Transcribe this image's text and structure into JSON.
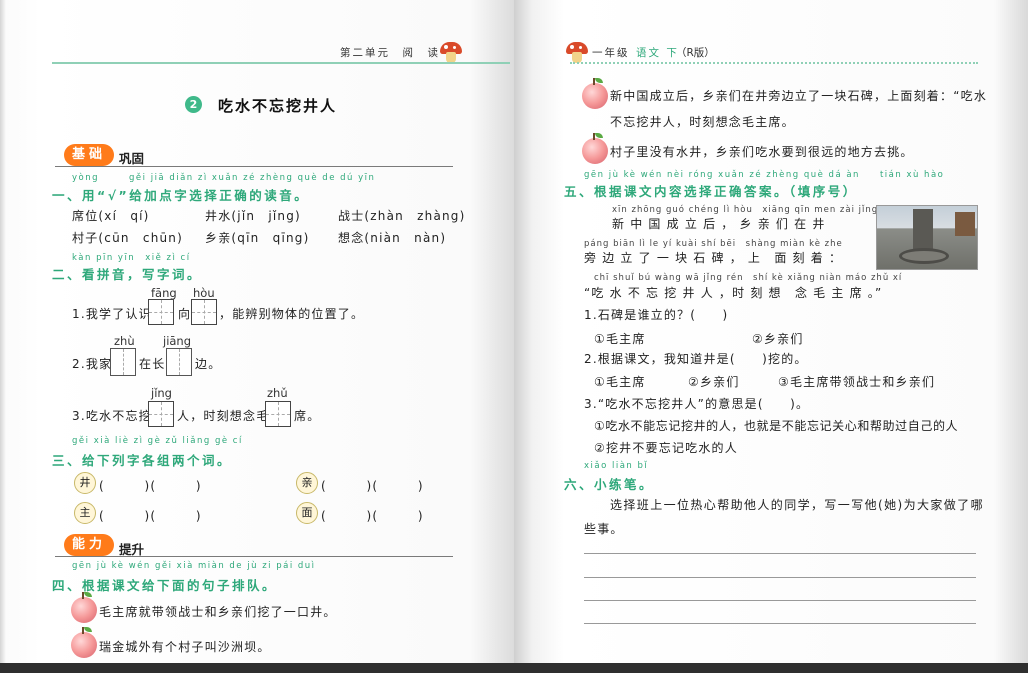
{
  "left_page": {
    "header": "第二单元　阅　读",
    "lesson_number": "2",
    "lesson_title": "吃水不忘挖井人",
    "basics_badge": "基础",
    "basics_label": "巩固",
    "q1": {
      "pinyin": "yòng　　　gěi jiā diǎn zì xuǎn zé zhèng què de dú yīn",
      "title": "一、用“√”给加点字选择正确的读音。",
      "row1": [
        "席位(xí　qí)",
        "井水(jǐn　jǐng)",
        "战士(zhàn　zhàng)"
      ],
      "row2": [
        "村子(cūn　chūn)",
        "乡亲(qīn　qīng)",
        "想念(niàn　nàn)"
      ]
    },
    "q2": {
      "pinyin": "kàn pīn yīn　xiě zì cí",
      "title": "二、看拼音，写字词。",
      "s1_py1": "fāng",
      "s1_py2": "hòu",
      "s1_a": "1.我学了认识",
      "s1_b": "向",
      "s1_c": "，能辨别物体的位置了。",
      "s2_py1": "zhù",
      "s2_py2": "jiāng",
      "s2_a": "2.我家",
      "s2_b": "在长",
      "s2_c": "边。",
      "s3_py1": "jǐng",
      "s3_py2": "zhǔ",
      "s3_a": "3.吃水不忘挖",
      "s3_b": "人，时刻想念毛",
      "s3_c": "席。"
    },
    "q3": {
      "pinyin": "gěi xià liè zì gè zǔ liǎng gè cí",
      "title": "三、给下列字各组两个词。",
      "chars": [
        "井",
        "亲",
        "主",
        "面"
      ],
      "blank": "(　　　)(　　　)"
    },
    "ability_badge": "能力",
    "ability_label": "提升",
    "q4": {
      "pinyin": "gēn jù kè wén gěi xià miàn de jù zi pái duì",
      "title": "四、根据课文给下面的句子排队。",
      "items": [
        "毛主席就带领战士和乡亲们挖了一口井。",
        "瑞金城外有个村子叫沙洲坝。"
      ]
    }
  },
  "right_page": {
    "header_grade": "一年级",
    "header_subject": "语文 下",
    "header_edition": "（R版）",
    "q4_items": [
      "新中国成立后，乡亲们在井旁边立了一块石碑，上面刻着：“吃水",
      "不忘挖井人，时刻想念毛主席。",
      "村子里没有水井，乡亲们吃水要到很远的地方去挑。"
    ],
    "q5": {
      "pinyin": "gēn jù kè wén nèi róng xuǎn zé zhèng què dá àn　　tián xù hào",
      "title": "五、根据课文内容选择正确答案。（填序号）",
      "passage_py1": "xīn zhōng guó chéng lì hòu　xiāng qīn men zài jǐng",
      "passage_1": "新 中 国 成 立 后 ， 乡 亲 们 在 井",
      "passage_py2": "páng biān lì le yí kuài shí bēi　shàng miàn kè zhe",
      "passage_2": "旁 边 立 了 一 块 石 碑 ， 上　面 刻 着 ：",
      "passage_py3": "chī shuǐ bú wàng wā jǐng rén　shí kè xiǎng niàn máo zhǔ xí",
      "passage_3": "“吃 水 不 忘 挖 井 人 ，时 刻 想　念 毛 主 席 。”",
      "sub1": "1.石碑是谁立的？(　　)",
      "sub1_opts": [
        "①毛主席",
        "②乡亲们"
      ],
      "sub2": "2.根据课文，我知道井是(　　)挖的。",
      "sub2_opts": [
        "①毛主席",
        "②乡亲们",
        "③毛主席带领战士和乡亲们"
      ],
      "sub3": "3.“吃水不忘挖井人”的意思是(　　)。",
      "sub3_opts": [
        "①吃水不能忘记挖井的人，也就是不能忘记关心和帮助过自己的人",
        "②挖井不要忘记吃水的人"
      ]
    },
    "q6": {
      "pinyin": "xiǎo liàn bǐ",
      "title": "六、小练笔。",
      "prompt_1": "选择班上一位热心帮助他人的同学，写一写他(她)为大家做了哪",
      "prompt_2": "些事。"
    }
  }
}
